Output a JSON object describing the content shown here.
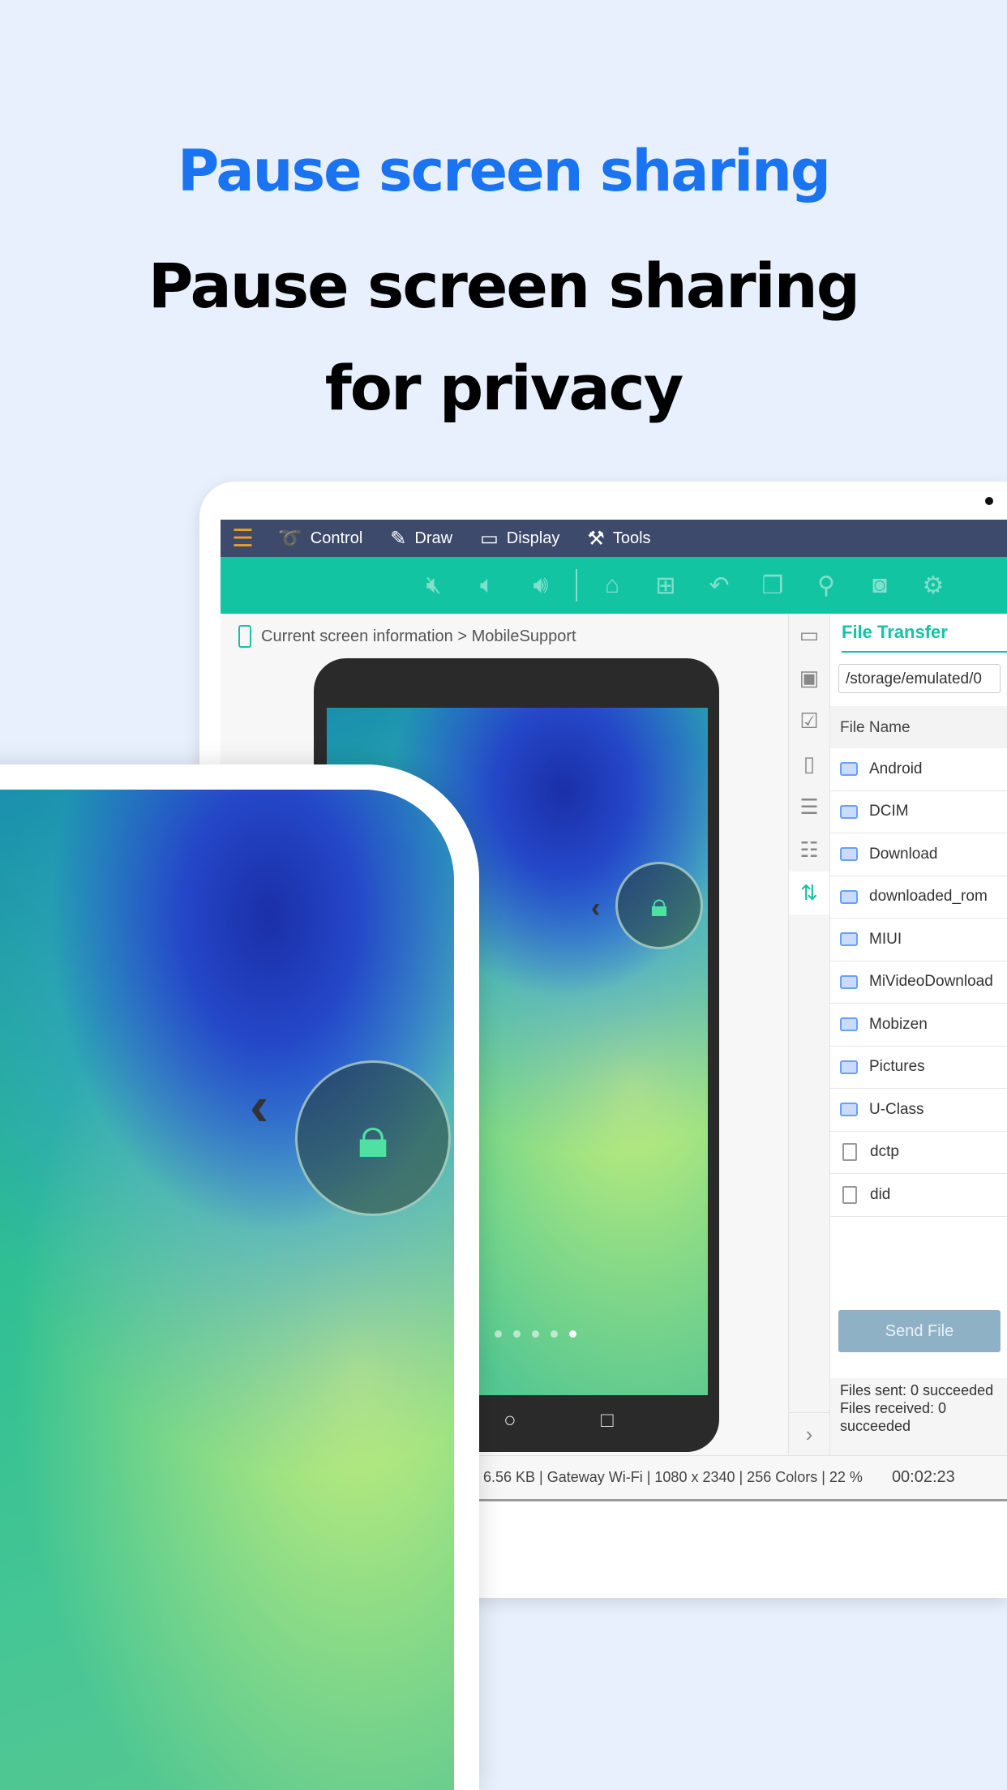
{
  "headline": {
    "title": "Pause screen sharing",
    "subtitle": "Pause screen sharing for privacy"
  },
  "nav": {
    "items": [
      {
        "label": "Control",
        "icon": "mouse-icon"
      },
      {
        "label": "Draw",
        "icon": "pencil-icon"
      },
      {
        "label": "Display",
        "icon": "monitor-icon"
      },
      {
        "label": "Tools",
        "icon": "tools-icon"
      }
    ]
  },
  "toolbar": {
    "icons": [
      "mute-icon",
      "volume-down-icon",
      "volume-up-icon",
      "home-icon",
      "apps-icon",
      "back-icon",
      "recent-apps-icon",
      "zoom-icon",
      "camera-icon",
      "settings-icon"
    ]
  },
  "breadcrumb": {
    "current": "Current screen information",
    "separator": ">",
    "device": "MobileSupport"
  },
  "file_transfer": {
    "title": "File Transfer",
    "path": "/storage/emulated/0",
    "column": "File Name",
    "files": [
      {
        "name": "Android",
        "type": "folder"
      },
      {
        "name": "DCIM",
        "type": "folder"
      },
      {
        "name": "Download",
        "type": "folder"
      },
      {
        "name": "downloaded_rom",
        "type": "folder"
      },
      {
        "name": "MIUI",
        "type": "folder"
      },
      {
        "name": "MiVideoDownload",
        "type": "folder"
      },
      {
        "name": "Mobizen",
        "type": "folder"
      },
      {
        "name": "Pictures",
        "type": "folder"
      },
      {
        "name": "U-Class",
        "type": "folder"
      },
      {
        "name": "dctp",
        "type": "file"
      },
      {
        "name": "did",
        "type": "file"
      }
    ],
    "send_label": "Send File",
    "sent": "Files sent: 0 succeeded",
    "received": "Files received: 0 succeeded"
  },
  "status": {
    "info": "6.56 KB | Gateway Wi-Fi | 1080 x 2340 | 256 Colors | 22 %",
    "timer": "00:02:23"
  },
  "colors": {
    "accent": "#13c4a3",
    "nav": "#3d4a6b",
    "headline": "#1a73f0"
  }
}
